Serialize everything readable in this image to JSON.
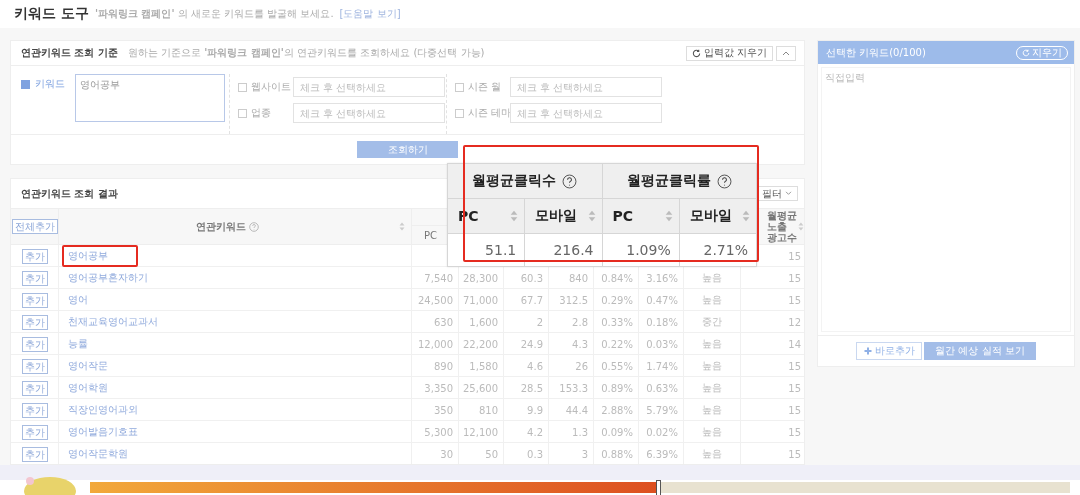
{
  "header": {
    "title": "키워드 도구",
    "subtitle": "**'파워링크 캠페인'** 의 새로운 키워드를 발굴해 보세요.",
    "help_link": "[도움말 보기]"
  },
  "query": {
    "title": "연관키워드 조회 기준",
    "description": "원하는 기준으로 **'파워링크 캠페인'**의 연관키워드를 조회하세요 (다중선택 가능)",
    "reset_button": "입력값 지우기",
    "keyword": {
      "label": "키워드",
      "checked": true,
      "value": "영어공부"
    },
    "filters": [
      {
        "label": "웹사이트",
        "checked": false,
        "placeholder": "체크 후 선택하세요"
      },
      {
        "label": "업종",
        "checked": false,
        "placeholder": "체크 후 선택하세요"
      },
      {
        "label": "시즌 월",
        "checked": false,
        "placeholder": "체크 후 선택하세요"
      },
      {
        "label": "시즌 테마",
        "checked": false,
        "placeholder": "체크 후 선택하세요"
      }
    ],
    "search_button": "조회하기"
  },
  "results": {
    "title": "연관키워드 조회 결과",
    "filter_button": "필터",
    "add_all_button": "전체추가",
    "keyword_header": "연관키워드",
    "pc_header": "PC",
    "ads_header": "월평균노출 광고수",
    "rows": [
      {
        "add": "추가",
        "keyword": "영어공부",
        "highlighted": true,
        "ads": "15"
      },
      {
        "add": "추가",
        "keyword": "영어공부혼자하기",
        "highlighted": false,
        "values": [
          "7,540",
          "28,300",
          "60.3",
          "840",
          "0.84%",
          "3.16%",
          "높음"
        ],
        "ads": "15"
      },
      {
        "add": "추가",
        "keyword": "영어",
        "highlighted": false,
        "values": [
          "24,500",
          "71,000",
          "67.7",
          "312.5",
          "0.29%",
          "0.47%",
          "높음"
        ],
        "ads": "15"
      },
      {
        "add": "추가",
        "keyword": "천재교육영어교과서",
        "highlighted": false,
        "values": [
          "630",
          "1,600",
          "2",
          "2.8",
          "0.33%",
          "0.18%",
          "중간"
        ],
        "ads": "12"
      },
      {
        "add": "추가",
        "keyword": "능률",
        "highlighted": false,
        "values": [
          "12,000",
          "22,200",
          "24.9",
          "4.3",
          "0.22%",
          "0.03%",
          "높음"
        ],
        "ads": "14"
      },
      {
        "add": "추가",
        "keyword": "영어작문",
        "highlighted": false,
        "values": [
          "890",
          "1,580",
          "4.6",
          "26",
          "0.55%",
          "1.74%",
          "높음"
        ],
        "ads": "15"
      },
      {
        "add": "추가",
        "keyword": "영어학원",
        "highlighted": false,
        "values": [
          "3,350",
          "25,600",
          "28.5",
          "153.3",
          "0.89%",
          "0.63%",
          "높음"
        ],
        "ads": "15"
      },
      {
        "add": "추가",
        "keyword": "직장인영어과외",
        "highlighted": false,
        "values": [
          "350",
          "810",
          "9.9",
          "44.4",
          "2.88%",
          "5.79%",
          "높음"
        ],
        "ads": "15"
      },
      {
        "add": "추가",
        "keyword": "영어발음기호표",
        "highlighted": false,
        "values": [
          "5,300",
          "12,100",
          "4.2",
          "1.3",
          "0.09%",
          "0.02%",
          "높음"
        ],
        "ads": "15"
      },
      {
        "add": "추가",
        "keyword": "영어작문학원",
        "highlighted": false,
        "values": [
          "30",
          "50",
          "0.3",
          "3",
          "0.88%",
          "6.39%",
          "높음"
        ],
        "ads": "15"
      }
    ]
  },
  "callout": {
    "highlighted": true,
    "groups": [
      {
        "title": "월평균클릭수",
        "columns": [
          {
            "label": "PC",
            "value": "51.1"
          },
          {
            "label": "모바일",
            "value": "216.4"
          }
        ]
      },
      {
        "title": "월평균클릭률",
        "columns": [
          {
            "label": "PC",
            "value": "1.09%"
          },
          {
            "label": "모바일",
            "value": "2.71%"
          }
        ]
      }
    ]
  },
  "side": {
    "title": "선택한 키워드(0/100)",
    "clear_button": "지우기",
    "placeholder": "직접입력",
    "add_button": "바로추가",
    "forecast_button": "월간 예상 실적 보기"
  },
  "player": {
    "level": 0.58
  }
}
